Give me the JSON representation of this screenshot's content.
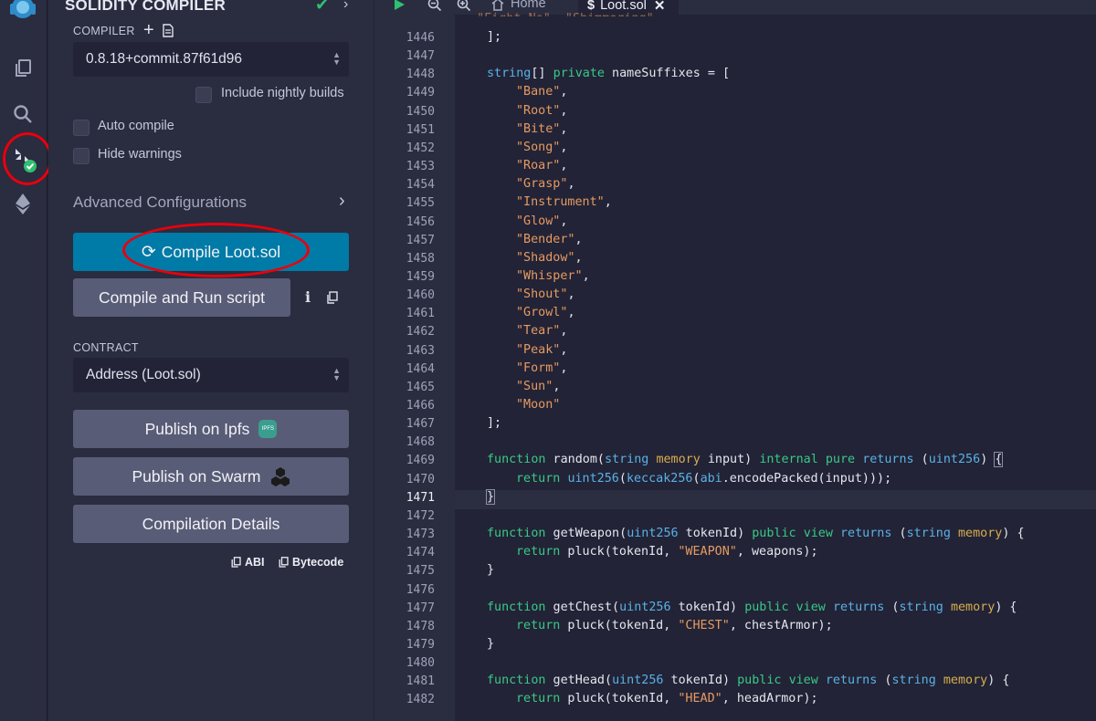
{
  "panel": {
    "title": "SOLIDITY COMPILER",
    "compiler_label": "COMPILER",
    "compiler_version": "0.8.18+commit.87f61d96",
    "include_nightly": "Include nightly builds",
    "auto_compile": "Auto compile",
    "hide_warnings": "Hide warnings",
    "advanced": "Advanced Configurations",
    "compile_button": "Compile Loot.sol",
    "compile_run_button": "Compile and Run script",
    "contract_label": "CONTRACT",
    "contract_value": "Address (Loot.sol)",
    "publish_ipfs": "Publish on Ipfs",
    "ipfs_badge": "IPFS",
    "publish_swarm": "Publish on Swarm",
    "compilation_details": "Compilation Details",
    "abi": "ABI",
    "bytecode": "Bytecode"
  },
  "editor": {
    "tabs": {
      "home": "Home",
      "file": "Loot.sol"
    },
    "active_line": "1471",
    "lines": [
      {
        "n": "1446",
        "text": "];"
      },
      {
        "n": "1447",
        "text": ""
      },
      {
        "n": "1448",
        "text": "string[] private nameSuffixes = ["
      },
      {
        "n": "1449",
        "text": "\"Bane\","
      },
      {
        "n": "1450",
        "text": "\"Root\","
      },
      {
        "n": "1451",
        "text": "\"Bite\","
      },
      {
        "n": "1452",
        "text": "\"Song\","
      },
      {
        "n": "1453",
        "text": "\"Roar\","
      },
      {
        "n": "1454",
        "text": "\"Grasp\","
      },
      {
        "n": "1455",
        "text": "\"Instrument\","
      },
      {
        "n": "1456",
        "text": "\"Glow\","
      },
      {
        "n": "1457",
        "text": "\"Bender\","
      },
      {
        "n": "1458",
        "text": "\"Shadow\","
      },
      {
        "n": "1459",
        "text": "\"Whisper\","
      },
      {
        "n": "1460",
        "text": "\"Shout\","
      },
      {
        "n": "1461",
        "text": "\"Growl\","
      },
      {
        "n": "1462",
        "text": "\"Tear\","
      },
      {
        "n": "1463",
        "text": "\"Peak\","
      },
      {
        "n": "1464",
        "text": "\"Form\","
      },
      {
        "n": "1465",
        "text": "\"Sun\","
      },
      {
        "n": "1466",
        "text": "\"Moon\""
      },
      {
        "n": "1467",
        "text": "];"
      },
      {
        "n": "1468",
        "text": ""
      },
      {
        "n": "1469",
        "text": "function random(string memory input) internal pure returns (uint256) {"
      },
      {
        "n": "1470",
        "text": "return uint256(keccak256(abi.encodePacked(input)));"
      },
      {
        "n": "1471",
        "text": "}"
      },
      {
        "n": "1472",
        "text": ""
      },
      {
        "n": "1473",
        "text": "function getWeapon(uint256 tokenId) public view returns (string memory) {"
      },
      {
        "n": "1474",
        "text": "return pluck(tokenId, \"WEAPON\", weapons);"
      },
      {
        "n": "1475",
        "text": "}"
      },
      {
        "n": "1476",
        "text": ""
      },
      {
        "n": "1477",
        "text": "function getChest(uint256 tokenId) public view returns (string memory) {"
      },
      {
        "n": "1478",
        "text": "return pluck(tokenId, \"CHEST\", chestArmor);"
      },
      {
        "n": "1479",
        "text": "}"
      },
      {
        "n": "1480",
        "text": ""
      },
      {
        "n": "1481",
        "text": "function getHead(uint256 tokenId) public view returns (string memory) {"
      },
      {
        "n": "1482",
        "text": "return pluck(tokenId, \"HEAD\", headArmor);"
      }
    ]
  },
  "colors": {
    "accent": "#007aa6",
    "highlight_circle": "#e8000d",
    "check_green": "#2fbf71"
  }
}
